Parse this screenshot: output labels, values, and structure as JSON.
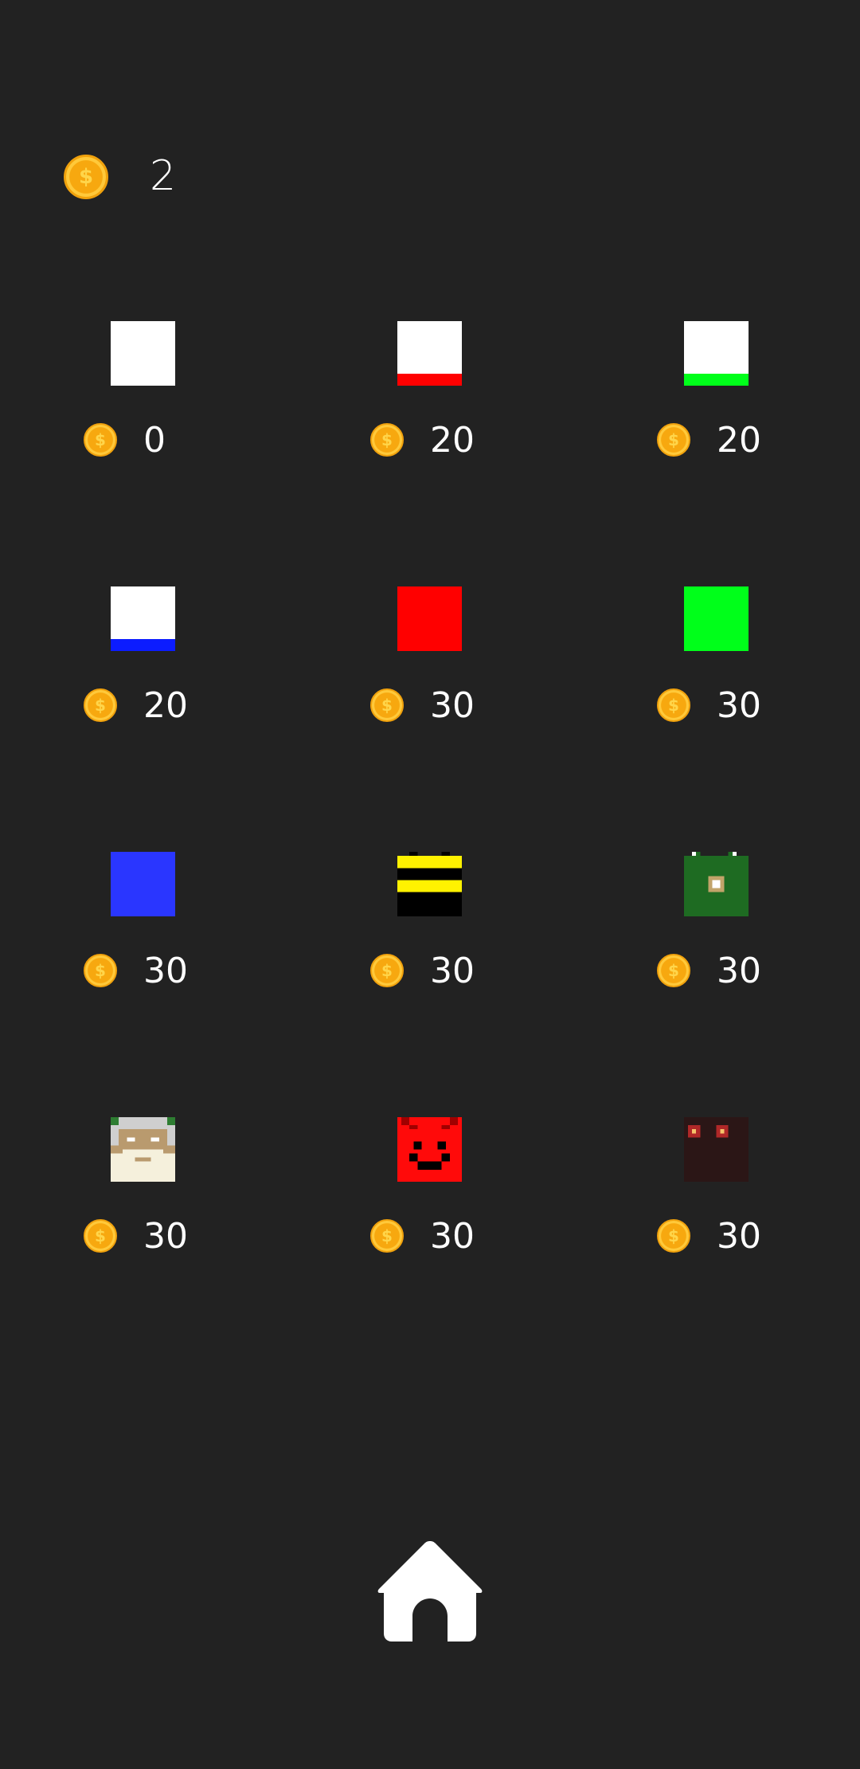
{
  "balance": {
    "icon": "coin-icon",
    "value": "2"
  },
  "shop": {
    "items": [
      {
        "id": "white",
        "price": "0",
        "skin": "white-square"
      },
      {
        "id": "white-red",
        "price": "20",
        "skin": "white-square-red-base"
      },
      {
        "id": "white-green",
        "price": "20",
        "skin": "white-square-green-base"
      },
      {
        "id": "white-blue",
        "price": "20",
        "skin": "white-square-blue-base"
      },
      {
        "id": "red",
        "price": "30",
        "skin": "red-square"
      },
      {
        "id": "green",
        "price": "30",
        "skin": "green-square"
      },
      {
        "id": "blue",
        "price": "30",
        "skin": "blue-square"
      },
      {
        "id": "bee",
        "price": "30",
        "skin": "bee-face"
      },
      {
        "id": "frog",
        "price": "30",
        "skin": "frog-face"
      },
      {
        "id": "old-man",
        "price": "30",
        "skin": "old-man-face"
      },
      {
        "id": "devil",
        "price": "30",
        "skin": "devil-face"
      },
      {
        "id": "shadow",
        "price": "30",
        "skin": "shadow-face"
      }
    ]
  },
  "colors": {
    "background": "#222222",
    "coin": "#f7a80f",
    "text": "#ffffff",
    "red": "#ff0000",
    "green": "#00ff1a",
    "blue": "#0c1cff"
  },
  "navigation": {
    "home_icon": "home-icon"
  }
}
